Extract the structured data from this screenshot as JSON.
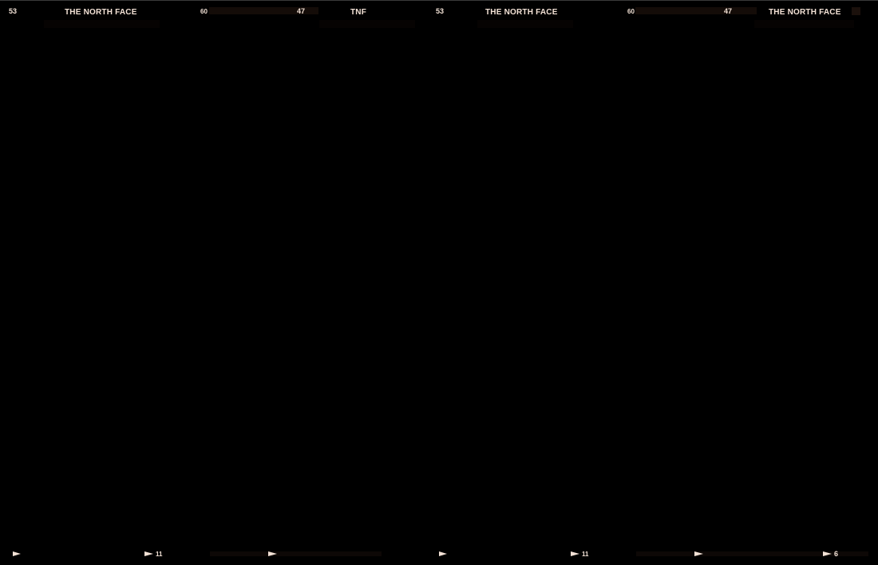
{
  "top_strip": {
    "left": {
      "frame_number_1": "53",
      "brand_1": "THE NORTH FACE",
      "frame_number_2": "60",
      "frame_number_3": "47",
      "brand_short": "TNF"
    },
    "right": {
      "frame_number_1": "53",
      "brand_1": "THE NORTH FACE",
      "frame_number_2": "60",
      "frame_number_3": "47",
      "brand_2": "THE NORTH FACE"
    }
  },
  "bottom_strip": {
    "left": {
      "frame_label_1": "11"
    },
    "right": {
      "frame_label_1": "11",
      "frame_label_2": "6"
    }
  },
  "colors": {
    "background": "#000000",
    "text": "#f3e2d6",
    "band": "#140c08"
  }
}
